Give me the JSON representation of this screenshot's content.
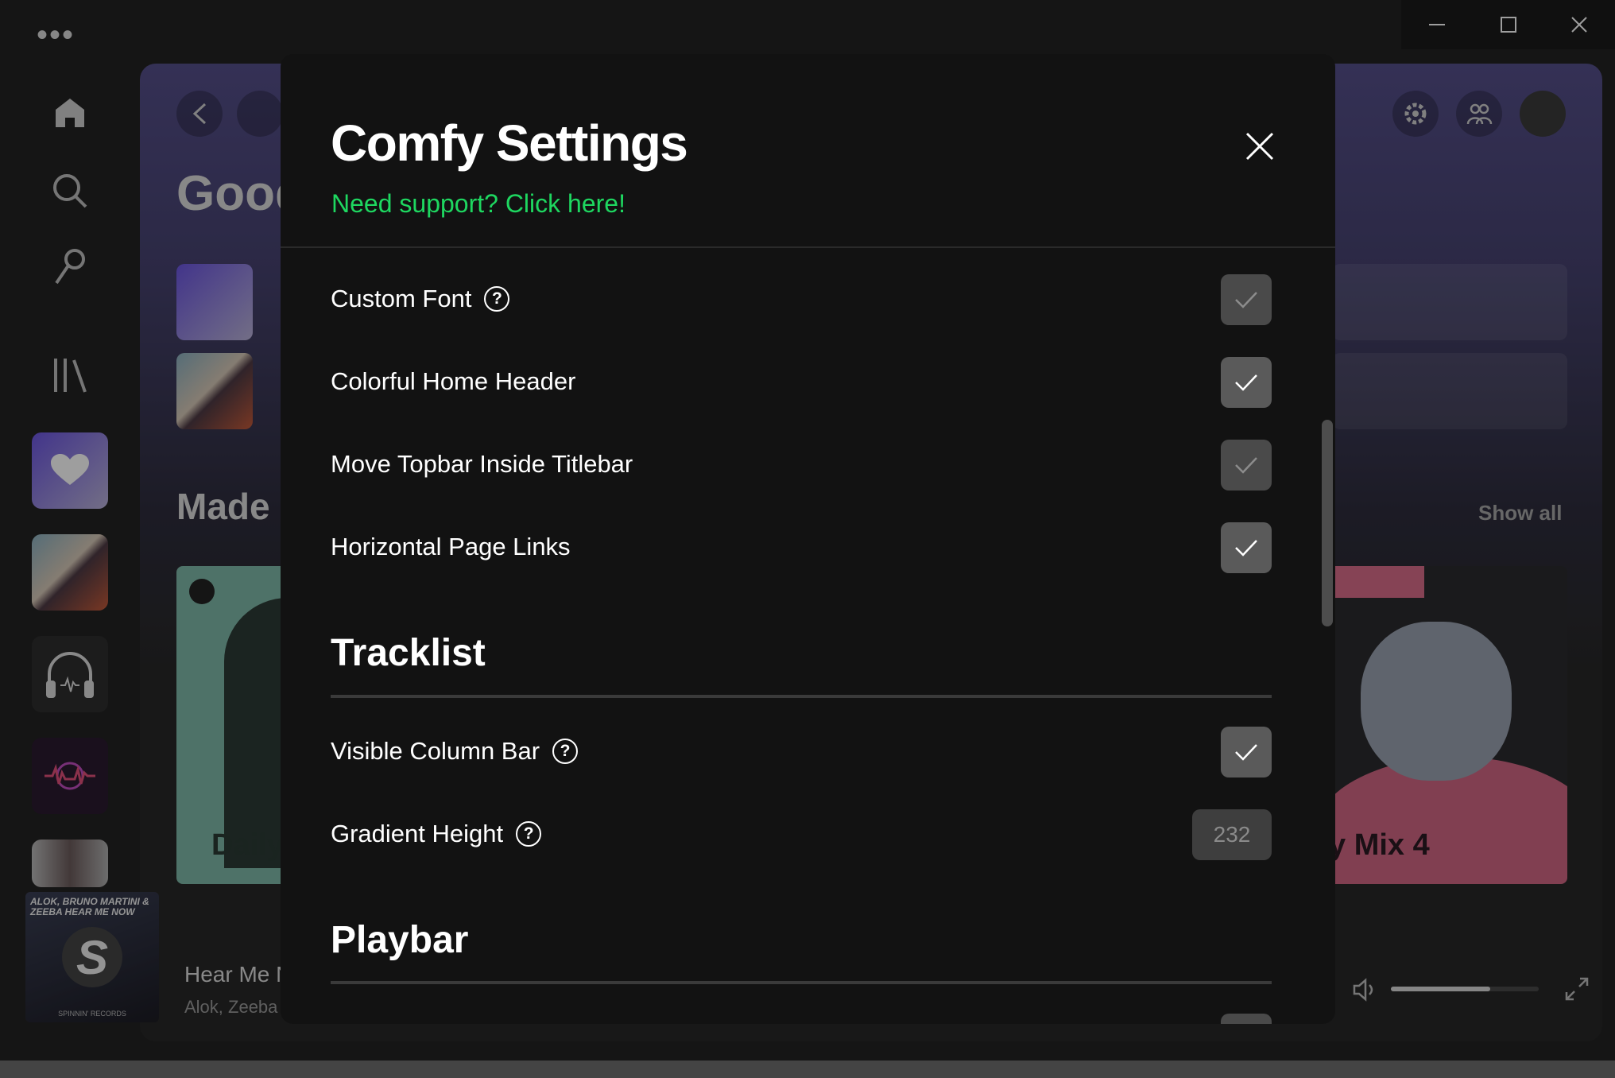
{
  "window": {
    "menu_dots": "•••",
    "controls": [
      "minimize-icon",
      "maximize-icon",
      "close-icon"
    ]
  },
  "rail": {
    "icons": [
      "home-icon",
      "search-icon",
      "microphone-icon",
      "library-icon"
    ]
  },
  "background": {
    "greeting": "Good",
    "made_heading": "Made",
    "show_all": "Show all",
    "card_left_title": "Daily",
    "card_right_title": "y Mix 4",
    "now_playing": {
      "title": "Hear Me N",
      "artist": "Alok, Zeeba",
      "album_art_text": "ALOK, BRUNO MARTINI & ZEEBA HEAR ME NOW",
      "album_label": "SPINNIN' RECORDS"
    },
    "volume_level": 0.67
  },
  "modal": {
    "title": "Comfy Settings",
    "support_link": "Need support? Click here!",
    "settings": [
      {
        "label": "Custom Font",
        "help": true,
        "checked": false
      },
      {
        "label": "Colorful Home Header",
        "help": false,
        "checked": true
      },
      {
        "label": "Move Topbar Inside Titlebar",
        "help": false,
        "checked": false
      },
      {
        "label": "Horizontal Page Links",
        "help": false,
        "checked": true
      }
    ],
    "sections": [
      {
        "title": "Tracklist",
        "settings": [
          {
            "label": "Visible Column Bar",
            "help": true,
            "checked": true
          },
          {
            "label": "Gradient Height",
            "help": true,
            "value": "232"
          }
        ]
      },
      {
        "title": "Playbar",
        "settings": []
      }
    ],
    "help_glyph": "?"
  }
}
